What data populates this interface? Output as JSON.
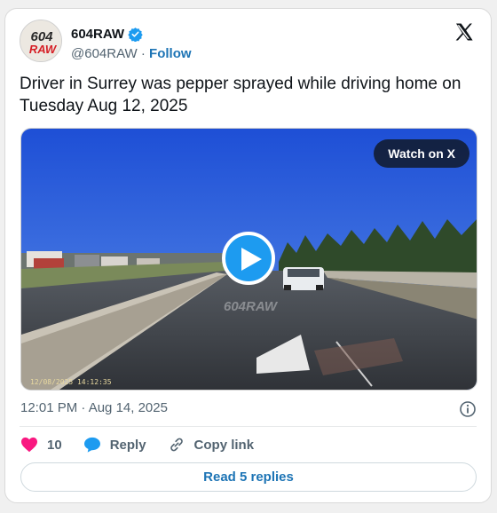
{
  "author": {
    "display_name": "604RAW",
    "handle": "@604RAW",
    "separator": "·",
    "follow_label": "Follow",
    "avatar_text_top": "604",
    "avatar_text_bottom": "RAW"
  },
  "tweet": {
    "text": "Driver in Surrey was pepper sprayed while driving home on Tuesday Aug 12, 2025"
  },
  "media": {
    "watch_label": "Watch on X",
    "watermark": "604RAW",
    "dashcam_timestamp": "12/08/2025 14:12:35"
  },
  "meta": {
    "time": "12:01 PM · Aug 14, 2025"
  },
  "actions": {
    "like_count": "10",
    "reply_label": "Reply",
    "copy_link_label": "Copy link"
  },
  "replies": {
    "label": "Read 5 replies"
  },
  "colors": {
    "accent": "#1d9bf0",
    "link": "#1d74b5",
    "like": "#f91880"
  }
}
